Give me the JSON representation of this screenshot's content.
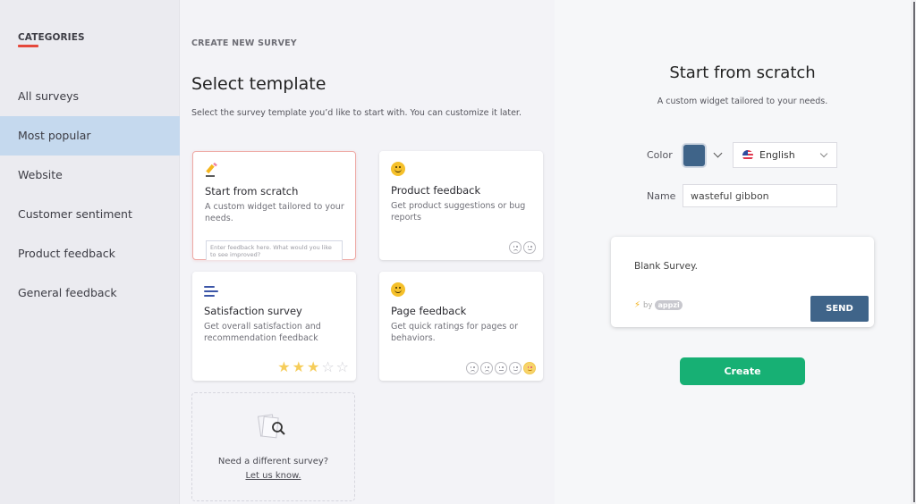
{
  "sidebar": {
    "title": "CATEGORIES",
    "items": [
      {
        "label": "All surveys",
        "active": false
      },
      {
        "label": "Most popular",
        "active": true
      },
      {
        "label": "Website",
        "active": false
      },
      {
        "label": "Customer sentiment",
        "active": false
      },
      {
        "label": "Product feedback",
        "active": false
      },
      {
        "label": "General feedback",
        "active": false
      }
    ]
  },
  "main": {
    "breadcrumb": "CREATE NEW SURVEY",
    "title": "Select template",
    "subtitle": "Select the survey template you’d like to start with. You can customize it later.",
    "templates": [
      {
        "icon": "pencil-icon",
        "title": "Start from scratch",
        "description": "A custom widget tailored to your needs.",
        "input_placeholder": "Enter feedback here.  What would you like to see improved?",
        "selected": true
      },
      {
        "icon": "smiley-icon",
        "title": "Product feedback",
        "description": "Get product suggestions or bug reports",
        "faces": [
          "sad",
          "happy"
        ]
      },
      {
        "icon": "lines-icon",
        "title": "Satisfaction survey",
        "description": "Get overall satisfaction and recommendation feedback",
        "rating": {
          "value": 3,
          "max": 5
        }
      },
      {
        "icon": "smiley-icon",
        "title": "Page feedback",
        "description": "Get quick ratings for pages or behaviors.",
        "faces": [
          "sad",
          "sad",
          "neutral",
          "happy",
          "love"
        ]
      }
    ],
    "ask": {
      "text": "Need a different survey?",
      "link": "Let us know."
    }
  },
  "detail": {
    "title": "Start from scratch",
    "subtitle": "A custom widget tailored to your needs.",
    "color_label": "Color",
    "color_value": "#3f6489",
    "language": "English",
    "name_label": "Name",
    "name_value": "wasteful gibbon",
    "preview": {
      "text": "Blank Survey.",
      "brand_by": "by",
      "brand_name": "appzi",
      "send_label": "SEND"
    },
    "create_label": "Create"
  },
  "colors": {
    "accent_red": "#e5483b",
    "active_category": "#c5d9ee",
    "primary_blue": "#3f6489",
    "create_green": "#17b074"
  }
}
